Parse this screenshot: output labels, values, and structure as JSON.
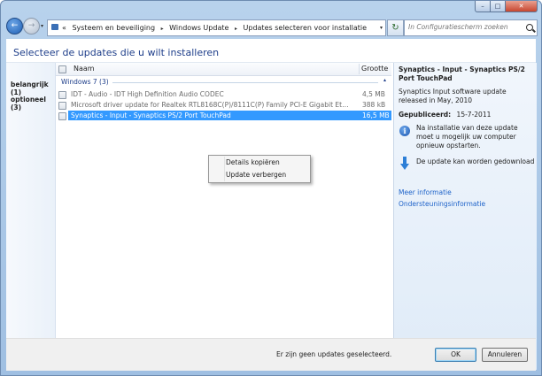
{
  "window": {
    "min_glyph": "–",
    "max_glyph": "□",
    "close_glyph": "✕"
  },
  "nav": {
    "back_glyph": "←",
    "forward_glyph": "→",
    "dropdown_glyph": "▾"
  },
  "address": {
    "prefix": "«",
    "crumbs": [
      "Systeem en beveiliging",
      "Windows Update",
      "Updates selecteren voor installatie"
    ],
    "separator": "▸",
    "dropdown_glyph": "▾",
    "refresh_glyph": "↻"
  },
  "search": {
    "placeholder": "In Configuratiescherm zoeken"
  },
  "heading": "Selecteer de updates die u wilt installeren",
  "categories": [
    {
      "label": "belangrijk (1)"
    },
    {
      "label": "optioneel (3)"
    }
  ],
  "table": {
    "col_name": "Naam",
    "col_size": "Grootte",
    "group_label": "Windows 7 (3)",
    "group_chevron": "▴",
    "rows": [
      {
        "name": "IDT - Audio - IDT High Definition Audio CODEC",
        "size": "4,5 MB"
      },
      {
        "name": "Microsoft driver update for Realtek RTL8168C(P)/8111C(P) Family PCI-E Gigabit Ethernet NIC ...",
        "size": "388 kB"
      },
      {
        "name": "Synaptics - Input - Synaptics PS/2 Port TouchPad",
        "size": "16,5 MB"
      }
    ]
  },
  "context_menu": {
    "items": [
      "Details kopiëren",
      "Update verbergen"
    ]
  },
  "details": {
    "title": "Synaptics - Input - Synaptics PS/2 Port TouchPad",
    "description": "Synaptics Input software update released in May, 2010",
    "published_label": "Gepubliceerd:",
    "published_value": "15-7-2011",
    "info_glyph": "i",
    "restart_note": "Na installatie van deze update moet u mogelijk uw computer opnieuw opstarten.",
    "download_note": "De update kan worden gedownload",
    "links": [
      "Meer informatie",
      "Ondersteuningsinformatie"
    ]
  },
  "footer": {
    "status": "Er zijn geen updates geselecteerd.",
    "ok_label": "OK",
    "cancel_label": "Annuleren"
  }
}
